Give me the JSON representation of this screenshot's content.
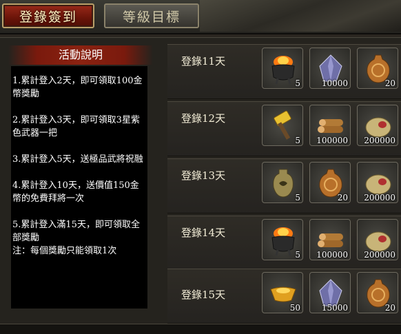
{
  "tabs": [
    {
      "label": "登錄簽到",
      "active": true
    },
    {
      "label": "等級目標",
      "active": false
    }
  ],
  "info": {
    "title": "活動說明",
    "lines": [
      "1.累計登入2天，即可領取100金幣獎勵",
      "2.累計登入3天，即可領取3星紫色武器一把",
      "3.累計登入5天，送極品武將祝融",
      "4.累計登入10天，送價值150金幣的免費拜將一次",
      "5.累計登入滿15天，即可領取全部獎勵",
      "注：每個獎勵只能領取1次"
    ]
  },
  "rewards": [
    {
      "label": "登錄11天",
      "items": [
        {
          "icon": "fire-cauldron-icon",
          "qty": "5"
        },
        {
          "icon": "crystal-icon",
          "qty": "10000"
        },
        {
          "icon": "token-icon",
          "qty": "20"
        }
      ]
    },
    {
      "label": "登錄12天",
      "items": [
        {
          "icon": "hammer-icon",
          "qty": "5"
        },
        {
          "icon": "wood-logs-icon",
          "qty": "100000"
        },
        {
          "icon": "grain-sack-icon",
          "qty": "200000"
        }
      ]
    },
    {
      "label": "登錄13天",
      "items": [
        {
          "icon": "tiger-tally-icon",
          "qty": "5"
        },
        {
          "icon": "token-icon",
          "qty": "20"
        },
        {
          "icon": "grain-sack-icon",
          "qty": "200000"
        }
      ]
    },
    {
      "label": "登錄14天",
      "items": [
        {
          "icon": "fire-cauldron-icon",
          "qty": "5"
        },
        {
          "icon": "wood-logs-icon",
          "qty": "100000"
        },
        {
          "icon": "grain-sack-icon",
          "qty": "200000"
        }
      ]
    },
    {
      "label": "登錄15天",
      "items": [
        {
          "icon": "gold-ingot-icon",
          "qty": "50"
        },
        {
          "icon": "crystal-icon",
          "qty": "15000"
        },
        {
          "icon": "token-icon",
          "qty": "20"
        }
      ]
    }
  ]
}
